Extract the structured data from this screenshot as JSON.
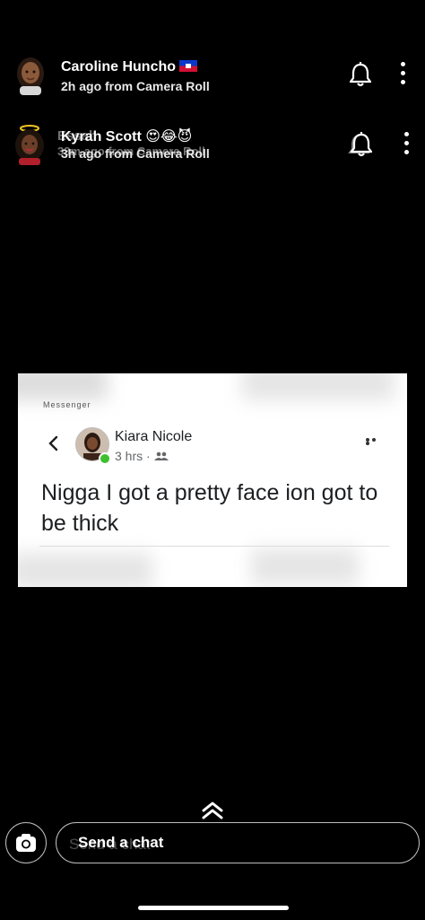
{
  "stories": [
    {
      "name": "Caroline Huncho",
      "flag": "haiti-flag",
      "time_source": "2h ago from Camera Roll"
    },
    {
      "name": "Kyrah Scott",
      "emojis": "😍😂😈",
      "time_source": "3h ago from Camera Roll",
      "ghost_name": "Essah",
      "ghost_time": "33m ago from Camera Roll"
    }
  ],
  "post": {
    "header_fragment": "Messenger",
    "name": "Kiara Nicole",
    "meta": "3 hrs · ",
    "text": "Nigga I got a pretty face ion got to be thick"
  },
  "chat": {
    "placeholder": "Send a chat",
    "ghost_placeholder": "Send a chat"
  },
  "icons": {
    "camera": "camera-icon",
    "bell": "bell-icon",
    "more": "more-vertical-icon",
    "swipe_up": "double-chevron-up-icon"
  },
  "colors": {
    "background": "#000000",
    "online": "#3ec02e"
  }
}
